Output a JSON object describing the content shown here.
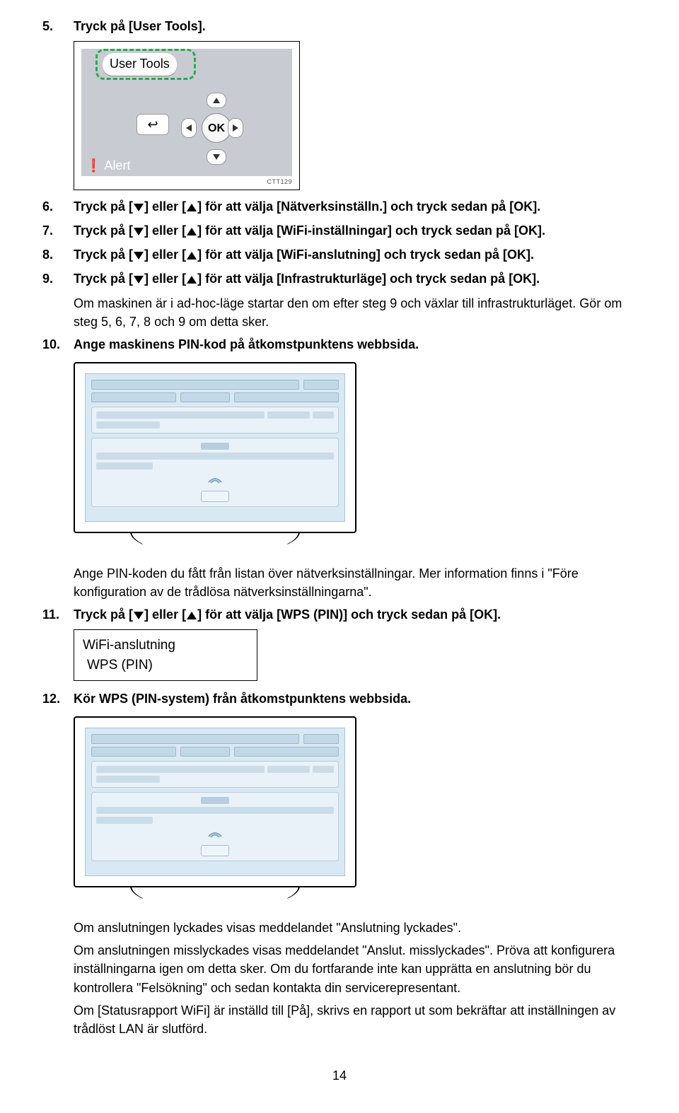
{
  "steps": {
    "s5": {
      "num": "5.",
      "text": "Tryck på [User Tools]."
    },
    "s6": {
      "num": "6.",
      "pre": "Tryck på [",
      "mid": "] eller [",
      "post": "] för att välja [Nätverksinställn.] och tryck sedan på [OK]."
    },
    "s7": {
      "num": "7.",
      "pre": "Tryck på [",
      "mid": "] eller [",
      "post": "] för att välja [WiFi-inställningar] och tryck sedan på [OK]."
    },
    "s8": {
      "num": "8.",
      "pre": "Tryck på [",
      "mid": "] eller [",
      "post": "] för att välja [WiFi-anslutning] och tryck sedan på [OK]."
    },
    "s9": {
      "num": "9.",
      "pre": "Tryck på [",
      "mid": "] eller [",
      "post": "] för att välja [Infrastrukturläge] och tryck sedan på [OK]."
    },
    "s9b": "Om maskinen är i ad-hoc-läge startar den om efter steg 9 och växlar till infrastrukturläget. Gör om steg 5, 6, 7, 8 och 9 om detta sker.",
    "s10": {
      "num": "10.",
      "text": "Ange maskinens PIN-kod på åtkomstpunktens webbsida."
    },
    "s10b": "Ange PIN-koden du fått från listan över nätverksinställningar. Mer information finns i \"Före konfiguration av de trådlösa nätverksinställningarna\".",
    "s11": {
      "num": "11.",
      "pre": "Tryck på [",
      "mid": "] eller [",
      "post": "] för att välja [WPS (PIN)] och tryck sedan på [OK]."
    },
    "s12": {
      "num": "12.",
      "text": "Kör WPS (PIN-system) från åtkomstpunktens webbsida."
    },
    "s12b": "Om anslutningen lyckades visas meddelandet \"Anslutning lyckades\".",
    "s12c": "Om anslutningen misslyckades visas meddelandet \"Anslut. misslyckades\". Pröva att konfigurera inställningarna igen om detta sker. Om du fortfarande inte kan upprätta en anslutning bör du kontrollera \"Felsökning\" och sedan kontakta din servicerepresentant.",
    "s12d": "Om [Statusrapport WiFi] är inställd till [På], skrivs en rapport ut som bekräftar att inställningen av trådlöst LAN är slutförd."
  },
  "panel": {
    "user_tools": "User Tools",
    "ok": "OK",
    "alert": "Alert",
    "code": "CTT129"
  },
  "lcd": {
    "line1": "WiFi-anslutning",
    "line2": "WPS   (PIN)"
  },
  "page_num": "14"
}
